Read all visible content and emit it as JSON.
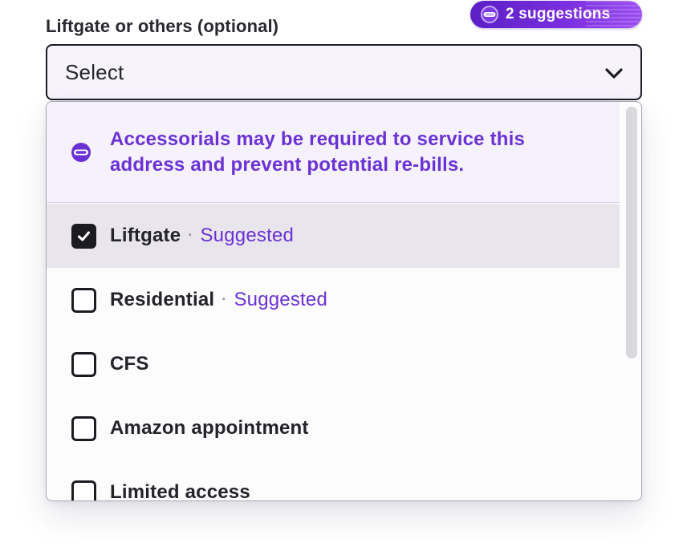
{
  "field": {
    "label": "Liftgate or others (optional)",
    "suggestions_badge": "2 suggestions",
    "badge_icon": "ai-visor-icon"
  },
  "select": {
    "value": "Select",
    "chevron_icon": "chevron-down-icon"
  },
  "dropdown": {
    "notice": {
      "icon": "ai-visor-icon",
      "line1": "Accessorials may be required to service this",
      "line2": "address and prevent potential re-bills."
    },
    "options": [
      {
        "label": "Liftgate",
        "checked": true,
        "suggested": "Suggested",
        "separator": "·"
      },
      {
        "label": "Residential",
        "checked": false,
        "suggested": "Suggested",
        "separator": "·"
      },
      {
        "label": "CFS",
        "checked": false
      },
      {
        "label": "Amazon appointment",
        "checked": false
      },
      {
        "label": "Limited access",
        "checked": false
      }
    ]
  },
  "colors": {
    "accent": "#6a32d4",
    "badge_start": "#5a1fc4",
    "badge_end": "#9b4df0",
    "selected_row": "#e8e6ec",
    "notice_bg": "#f5f1fd"
  }
}
